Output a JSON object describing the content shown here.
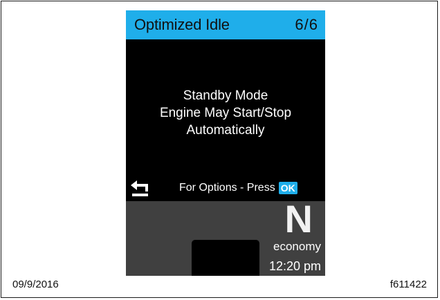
{
  "header": {
    "title": "Optimized Idle",
    "page": "6/6",
    "color": "#1faeea"
  },
  "message": {
    "line1": "Standby Mode",
    "line2": "Engine May Start/Stop",
    "line3": "Automatically"
  },
  "footer": {
    "back_icon": "back-arrow-icon",
    "options_text": "For Options - Press",
    "ok_label": "OK"
  },
  "status": {
    "gear": "N",
    "mode": "economy",
    "time": "12:20 pm"
  },
  "caption": {
    "date": "09/9/2016",
    "figure_id": "f611422"
  }
}
